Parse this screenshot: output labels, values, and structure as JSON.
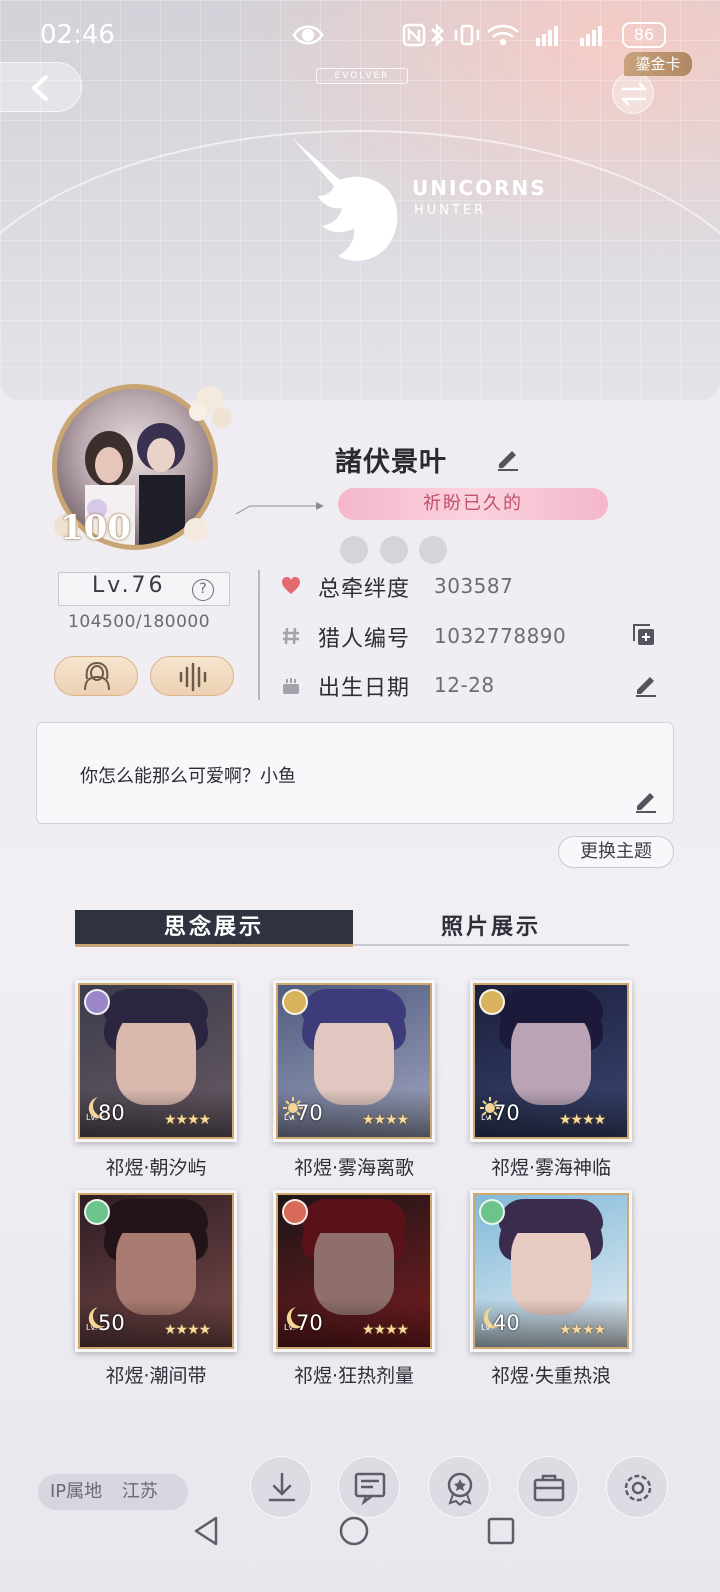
{
  "status_bar": {
    "time": "02:46",
    "battery": "86"
  },
  "banner": {
    "tag": "EVOLVER",
    "logo_title": "UNICORNS",
    "logo_sub": "HUNTER",
    "gold_card": "鎏金卡"
  },
  "profile": {
    "avatar_badge": "100",
    "nickname": "諸伏景叶",
    "title": "祈盼已久的",
    "level": "Lv.76",
    "exp": "104500/180000"
  },
  "stats": [
    {
      "label": "总牵绊度",
      "value": "303587",
      "icon": "heart-icon"
    },
    {
      "label": "猎人编号",
      "value": "1032778890",
      "icon": "hash-icon"
    },
    {
      "label": "出生日期",
      "value": "12-28",
      "icon": "cake-icon"
    }
  ],
  "signature": {
    "text": "你怎么能那么可爱啊？小鱼"
  },
  "theme_button": "更换主题",
  "tabs": [
    {
      "label": "思念展示",
      "active": true
    },
    {
      "label": "照片展示",
      "active": false
    }
  ],
  "cards": [
    {
      "name": "祁煜·朝汐屿",
      "level": "80",
      "attr_color": "#9b86c9",
      "level_icon": "moon-icon",
      "bg": [
        "#3b3a4a",
        "#6a5c66"
      ],
      "hair": "#2c2540",
      "face": "#d9b9ae"
    },
    {
      "name": "祁煜·雾海离歌",
      "level": "70",
      "attr_color": "#d8b25c",
      "level_icon": "sun-icon",
      "bg": [
        "#4e5a7e",
        "#a2a6c0"
      ],
      "hair": "#3e3b7a",
      "face": "#e1c7c0"
    },
    {
      "name": "祁煜·雾海神临",
      "level": "70",
      "attr_color": "#d8b25c",
      "level_icon": "sun-icon",
      "bg": [
        "#1b1f3c",
        "#3d4672"
      ],
      "hair": "#1c1a3a",
      "face": "#b9a3b4"
    },
    {
      "name": "祁煜·潮间带",
      "level": "50",
      "attr_color": "#6cc48c",
      "level_icon": "moon-icon",
      "bg": [
        "#2c1c22",
        "#7a4b4c"
      ],
      "hair": "#231419",
      "face": "#a87a70"
    },
    {
      "name": "祁煜·狂热剂量",
      "level": "70",
      "attr_color": "#d86a5a",
      "level_icon": "moon-icon",
      "bg": [
        "#1a1416",
        "#7a1e22"
      ],
      "hair": "#5a1218",
      "face": "#8e6f6c"
    },
    {
      "name": "祁煜·失重热浪",
      "level": "40",
      "attr_color": "#6cc48c",
      "level_icon": "moon-icon",
      "bg": [
        "#7fb8d8",
        "#e8eef4"
      ],
      "hair": "#3a2c4c",
      "face": "#e8cbc2"
    }
  ],
  "card_stars": "★★★★",
  "card_lv_label": "Lv.",
  "footer": {
    "ip_label": "IP属地",
    "ip_value": "江苏",
    "buttons": [
      "download-icon",
      "message-board-icon",
      "medal-icon",
      "bag-icon",
      "settings-icon"
    ]
  }
}
